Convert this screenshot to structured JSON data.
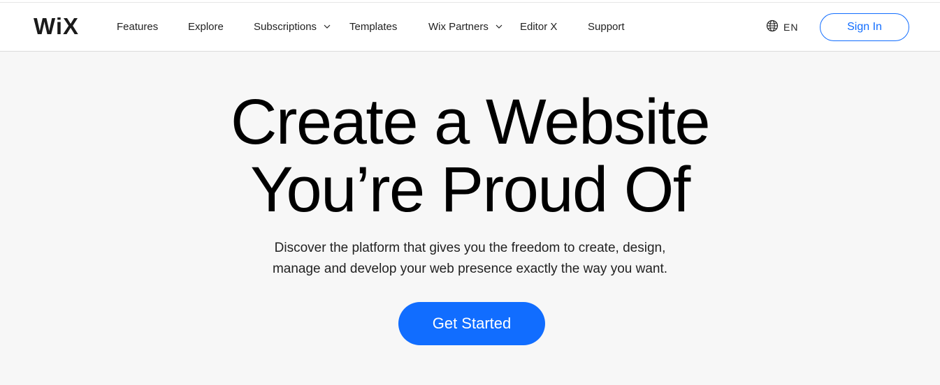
{
  "header": {
    "logo": "WiX",
    "nav": [
      {
        "label": "Features",
        "has_dropdown": false
      },
      {
        "label": "Explore",
        "has_dropdown": false
      },
      {
        "label": "Subscriptions",
        "has_dropdown": true
      },
      {
        "label": "Templates",
        "has_dropdown": false
      },
      {
        "label": "Wix Partners",
        "has_dropdown": true
      },
      {
        "label": "Editor X",
        "has_dropdown": false
      },
      {
        "label": "Support",
        "has_dropdown": false
      }
    ],
    "language": {
      "label": "EN",
      "icon": "globe-icon"
    },
    "sign_in_label": "Sign In"
  },
  "hero": {
    "title_line1": "Create a Website",
    "title_line2": "You’re Proud Of",
    "subtitle_line1": "Discover the platform that gives you the freedom to create, design,",
    "subtitle_line2": "manage and develop your web presence exactly the way you want.",
    "cta_label": "Get Started"
  },
  "colors": {
    "accent": "#116dff",
    "background": "#f7f7f7",
    "header_bg": "#ffffff",
    "text": "#000000"
  }
}
